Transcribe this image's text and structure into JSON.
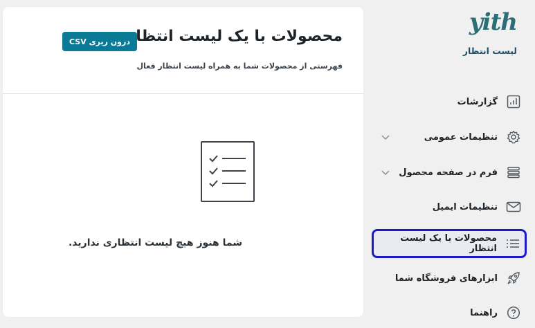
{
  "sidebar": {
    "logo_text": "yith",
    "plugin_name": "لیست انتظار",
    "items": [
      {
        "label": "گزارشات",
        "icon": "chart-icon"
      },
      {
        "label": "تنظیمات عمومی",
        "icon": "gear-icon"
      },
      {
        "label": "فرم در صفحه محصول",
        "icon": "form-rows-icon"
      },
      {
        "label": "تنظیمات ایمیل",
        "icon": "envelope-icon"
      },
      {
        "label": "محصولات با یک لیست انتظار",
        "icon": "list-icon"
      },
      {
        "label": "ابزارهای فروشگاه شما",
        "icon": "rocket-icon"
      },
      {
        "label": "راهنما",
        "icon": "help-circle-icon"
      }
    ]
  },
  "main": {
    "title": "محصولات با یک لیست انتظار",
    "export_button": "درون ریزی CSV",
    "subtitle": "فهرستی از محصولات شما به همراه لیست انتظار فعال",
    "empty_message": "شما هنوز هیچ لیست انتظاری ندارید."
  },
  "colors": {
    "accent": "#0a7a96",
    "active_border": "#1a1ac9",
    "brand": "#2c6e75"
  }
}
